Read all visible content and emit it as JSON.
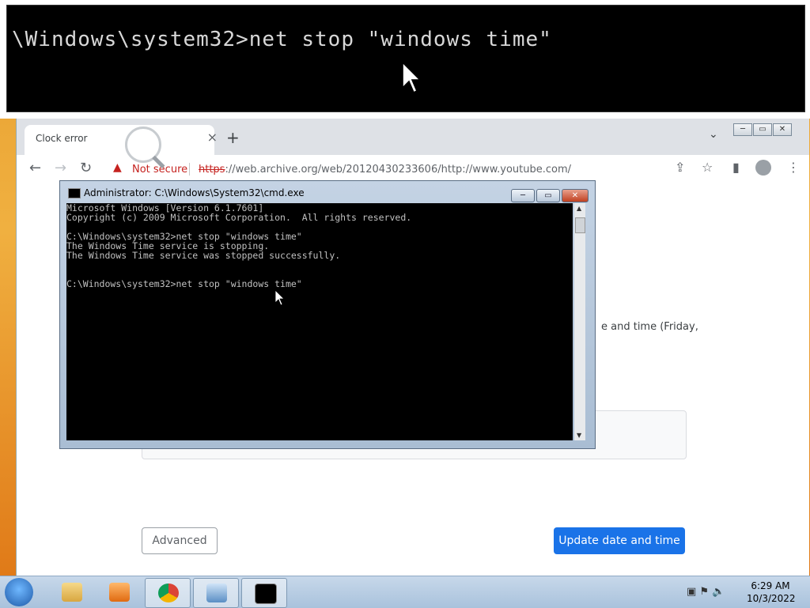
{
  "zoom": {
    "text": "\\Windows\\system32>net stop \"windows time\""
  },
  "browser": {
    "tab_title": "Clock error",
    "tab_close": "×",
    "new_tab": "+",
    "omnibox": {
      "warning": "Not secure",
      "url_scheme": "https",
      "url_rest": "://web.archive.org/web/20120430233606/http://www.youtube.com/"
    },
    "page": {
      "partial_text": "e and time (Friday,",
      "advanced_label": "Advanced",
      "update_label": "Update date and time"
    },
    "window_buttons": [
      "─",
      "▭",
      "✕"
    ]
  },
  "cmd": {
    "title": "Administrator: C:\\Windows\\System32\\cmd.exe",
    "buttons": [
      "─",
      "▭",
      "✕"
    ],
    "lines": [
      "Microsoft Windows [Version 6.1.7601]",
      "Copyright (c) 2009 Microsoft Corporation.  All rights reserved.",
      "",
      "C:\\Windows\\system32>net stop \"windows time\"",
      "The Windows Time service is stopping.",
      "The Windows Time service was stopped successfully.",
      "",
      "",
      "C:\\Windows\\system32>net stop \"windows time\""
    ]
  },
  "taskbar": {
    "time": "6:29 AM",
    "date": "10/3/2022",
    "items": [
      "explorer-icon",
      "media-player-icon",
      "chrome-icon",
      "magnifier-icon",
      "cmd-icon"
    ]
  },
  "colors": {
    "accent": "#1a73e8",
    "warning": "#c5221f"
  }
}
